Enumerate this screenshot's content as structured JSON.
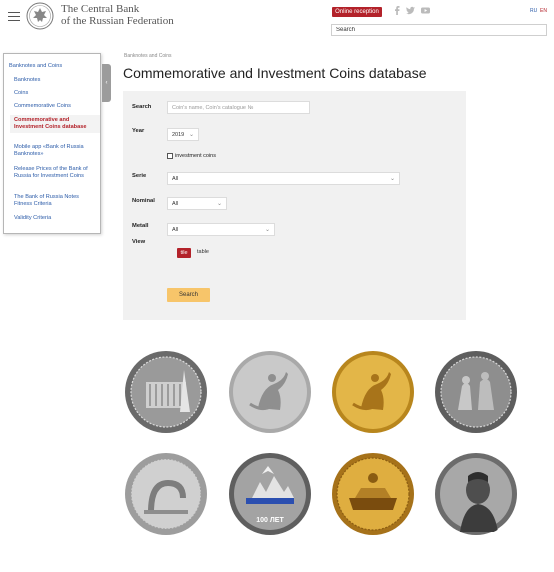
{
  "header": {
    "logo_line1": "The Central Bank",
    "logo_line2": "of the Russian Federation",
    "online_reception": "Online reception",
    "lang_ru": "RU",
    "lang_en": "EN",
    "search_value": "Search",
    "social_icons": [
      "facebook-icon",
      "twitter-icon",
      "youtube-icon"
    ]
  },
  "sidebar": {
    "top_item": "Banknotes and Coins",
    "toggle_glyph": "‹",
    "items": [
      "Banknotes",
      "Coins",
      "Commemorative Coins",
      "Commemorative and Investment Coins database",
      "Mobile app «Bank of Russia Banknotes»",
      "Release Prices of the Bank of Russia for Investment Coins",
      "The Bank of Russia Notes Fitness Criteria",
      "Validity Criteria"
    ],
    "active_index": 3
  },
  "main": {
    "breadcrumb": "Banknotes and Coins",
    "title": "Commemorative and Investment Coins database"
  },
  "filters": {
    "search_label": "Search",
    "search_placeholder": "Coin's name, Coin's catalogue №",
    "year_label": "Year",
    "year_value": "2019",
    "investment_label": "investment coins",
    "investment_checked": false,
    "serie_label": "Serie",
    "serie_value": "All",
    "nominal_label": "Nominal",
    "nominal_value": "All",
    "metal_label": "Metall",
    "metal_value": "All",
    "view_label": "View",
    "view_tile": "tile",
    "view_table": "table",
    "search_button": "Search"
  },
  "coins": [
    {
      "metal": "silver",
      "color": "#8d8d8d"
    },
    {
      "metal": "silver",
      "color": "#b9b9b9"
    },
    {
      "metal": "gold",
      "color": "#d8a62c"
    },
    {
      "metal": "silver",
      "color": "#7a7a7a"
    },
    {
      "metal": "silver",
      "color": "#c2c2c2"
    },
    {
      "metal": "silver",
      "color": "#8a8a8a",
      "accent": "#2b4fb0",
      "caption": "100 ЛЕТ"
    },
    {
      "metal": "gold",
      "color": "#cf9a24"
    },
    {
      "metal": "silver",
      "color": "#9a9a9a"
    }
  ],
  "colors": {
    "accent_red": "#b3222a",
    "link_blue": "#2b5ba8",
    "search_yellow": "#f7c56a",
    "panel_grey": "#f1f1f1"
  }
}
